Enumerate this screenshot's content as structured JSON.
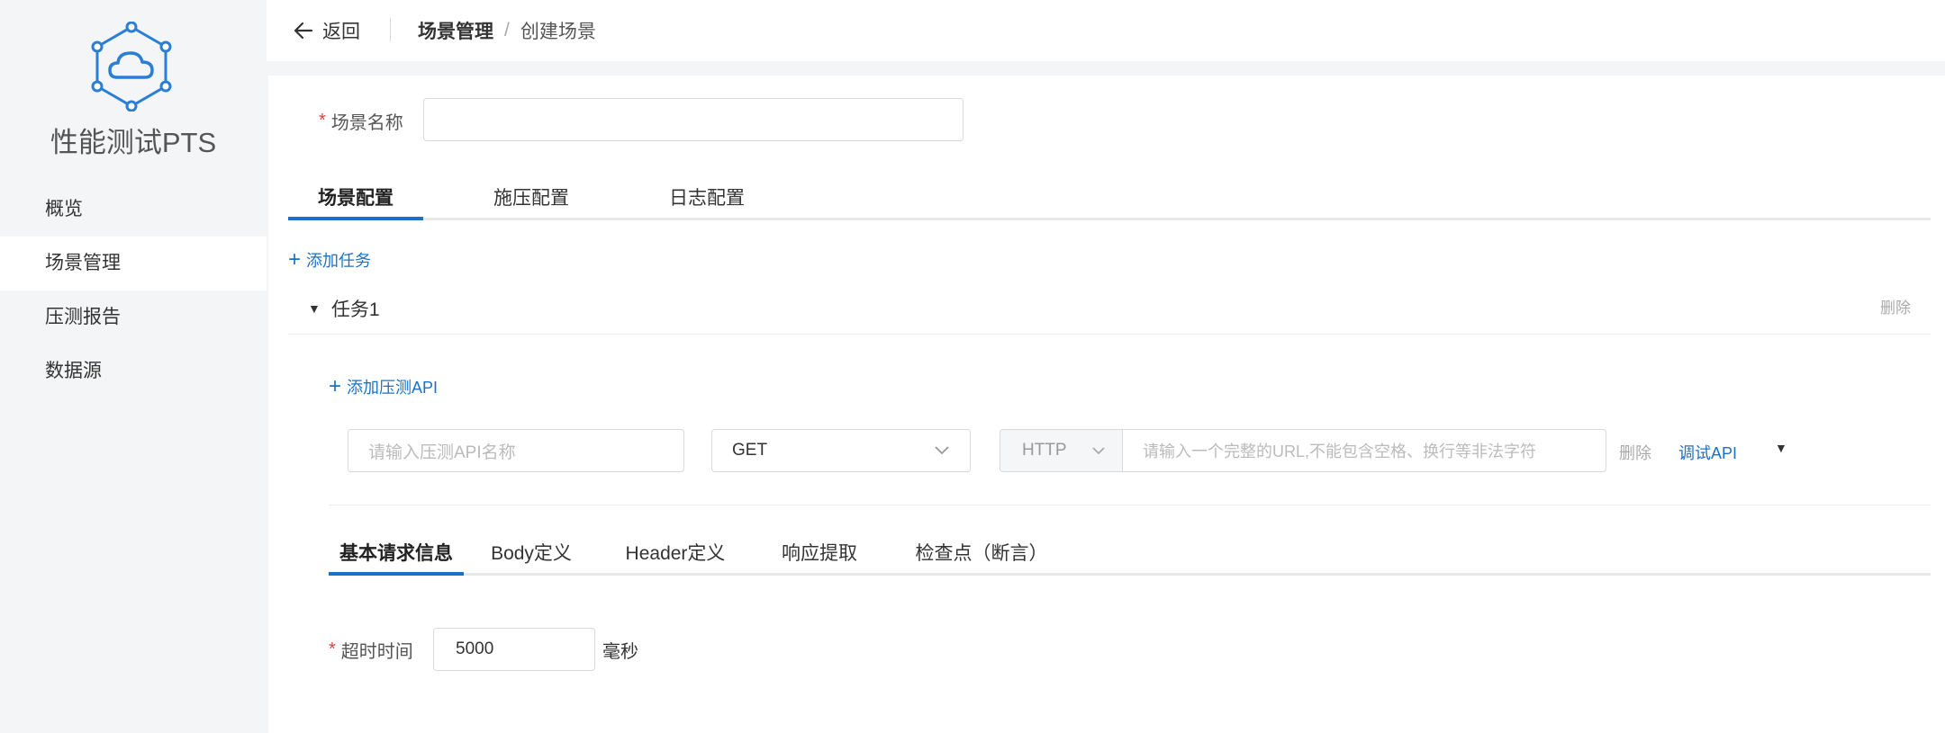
{
  "app": {
    "name": "性能测试PTS",
    "logo_icon": "cloud-hexagon-icon"
  },
  "sidebar": {
    "items": [
      {
        "label": "概览",
        "active": false
      },
      {
        "label": "场景管理",
        "active": true
      },
      {
        "label": "压测报告",
        "active": false
      },
      {
        "label": "数据源",
        "active": false
      }
    ]
  },
  "header": {
    "back_label": "返回",
    "breadcrumb": {
      "section": "场景管理",
      "separator": "/",
      "current": "创建场景"
    }
  },
  "scene": {
    "name_label": "场景名称",
    "name_value": "",
    "required_mark": "*"
  },
  "scene_tabs": [
    {
      "label": "场景配置",
      "active": true
    },
    {
      "label": "施压配置",
      "active": false
    },
    {
      "label": "日志配置",
      "active": false
    }
  ],
  "task_section": {
    "add_task_label": "添加任务",
    "task_title": "任务1",
    "delete_label": "删除",
    "add_api_label": "添加压测API"
  },
  "api": {
    "name_placeholder": "请输入压测API名称",
    "method": "GET",
    "protocol": "HTTP",
    "url_placeholder": "请输入一个完整的URL,不能包含空格、换行等非法字符",
    "delete_label": "删除",
    "debug_label": "调试API"
  },
  "request_tabs": [
    {
      "label": "基本请求信息",
      "active": true
    },
    {
      "label": "Body定义",
      "active": false
    },
    {
      "label": "Header定义",
      "active": false
    },
    {
      "label": "响应提取",
      "active": false
    },
    {
      "label": "检查点（断言）",
      "active": false
    }
  ],
  "timeout": {
    "label": "超时时间",
    "value": "5000",
    "unit": "毫秒"
  },
  "colors": {
    "accent": "#1a72c8",
    "required": "#e53a3a",
    "sidebar_bg": "#f4f5f6"
  }
}
